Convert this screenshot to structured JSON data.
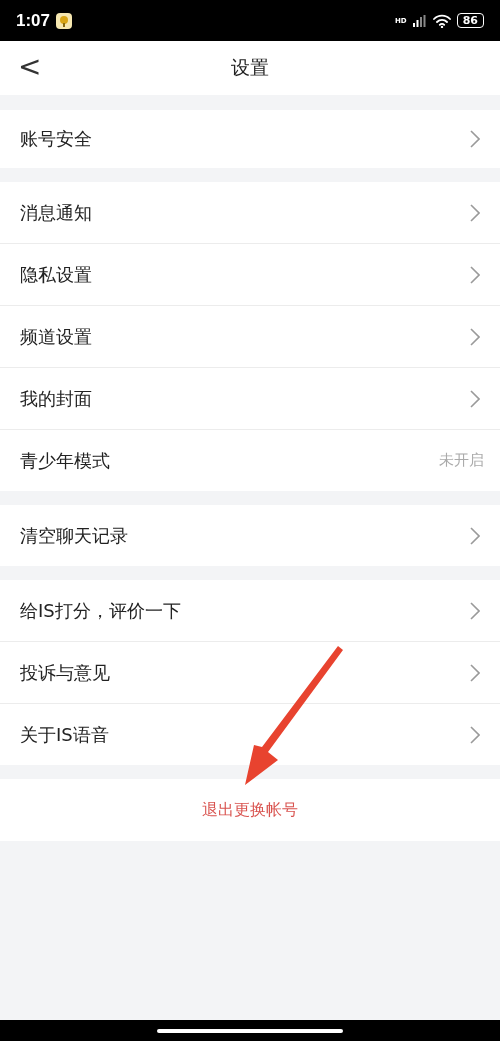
{
  "status_bar": {
    "time": "1:07",
    "network": "HD",
    "battery": "86"
  },
  "header": {
    "back": "<",
    "title": "设置"
  },
  "groups": [
    {
      "rows": [
        {
          "kind": "link",
          "label": "账号安全"
        }
      ]
    },
    {
      "rows": [
        {
          "kind": "link",
          "label": "消息通知"
        },
        {
          "kind": "link",
          "label": "隐私设置"
        },
        {
          "kind": "link",
          "label": "频道设置"
        },
        {
          "kind": "link",
          "label": "我的封面"
        },
        {
          "kind": "status",
          "label": "青少年模式",
          "value": "未开启"
        }
      ]
    },
    {
      "rows": [
        {
          "kind": "link",
          "label": "清空聊天记录"
        }
      ]
    },
    {
      "rows": [
        {
          "kind": "link",
          "label": "给IS打分，评价一下"
        },
        {
          "kind": "link",
          "label": "投诉与意见"
        },
        {
          "kind": "link",
          "label": "关于IS语音"
        }
      ]
    }
  ],
  "logout": {
    "label": "退出更换帐号"
  },
  "annotation": {
    "kind": "arrow"
  }
}
